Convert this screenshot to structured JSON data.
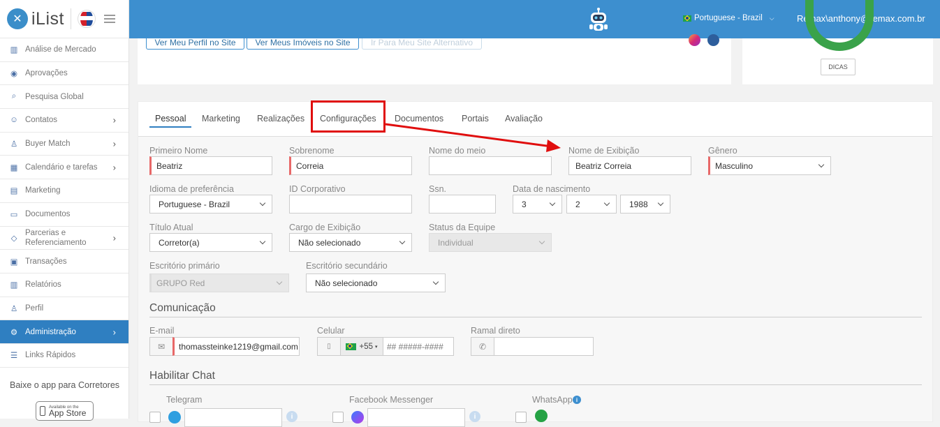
{
  "app": {
    "logo_text": "iList",
    "brand": "RE/MAX"
  },
  "sidebar": {
    "items": [
      {
        "label": "Análise de Mercado",
        "icon": "bar-chart-icon",
        "chevron": false
      },
      {
        "label": "Aprovações",
        "icon": "eye-icon",
        "chevron": false
      },
      {
        "label": "Pesquisa Global",
        "icon": "search-icon",
        "chevron": false
      },
      {
        "label": "Contatos",
        "icon": "contacts-icon",
        "chevron": true
      },
      {
        "label": "Buyer Match",
        "icon": "user-icon",
        "chevron": true
      },
      {
        "label": "Calendário e tarefas",
        "icon": "calendar-icon",
        "chevron": true
      },
      {
        "label": "Marketing",
        "icon": "newspaper-icon",
        "chevron": false
      },
      {
        "label": "Documentos",
        "icon": "folder-icon",
        "chevron": false
      },
      {
        "label": "Parcerias e Referenciamento",
        "icon": "tag-icon",
        "chevron": true
      },
      {
        "label": "Transações",
        "icon": "briefcase-icon",
        "chevron": false
      },
      {
        "label": "Relatórios",
        "icon": "bar-chart-icon",
        "chevron": false
      },
      {
        "label": "Perfil",
        "icon": "user-icon",
        "chevron": false
      },
      {
        "label": "Administração",
        "icon": "gear-icon",
        "chevron": true,
        "active": true
      },
      {
        "label": "Links Rápidos",
        "icon": "list-icon",
        "chevron": false
      }
    ],
    "app_text": "Baixe o app para Corretores",
    "appstore_small": "Available on the",
    "appstore_big": "App Store"
  },
  "topbar": {
    "language": "Portuguese - Brazil",
    "user": "Remax\\anthony@remax.com.br"
  },
  "top_card": {
    "btn1": "Ver Meu Perfil no Site",
    "btn2": "Ver Meus Imóveis no Site",
    "btn3": "Ir Para Meu Site Alternativo",
    "dicas": "DICAS"
  },
  "tabs": [
    "Pessoal",
    "Marketing",
    "Realizações",
    "Configurações",
    "Documentos",
    "Portais",
    "Avaliação"
  ],
  "form": {
    "primeiro_nome_label": "Primeiro Nome",
    "primeiro_nome": "Beatriz",
    "sobrenome_label": "Sobrenome",
    "sobrenome": "Correia",
    "nome_meio_label": "Nome do meio",
    "nome_meio": "",
    "nome_exibicao_label": "Nome de Exibição",
    "nome_exibicao": "Beatriz Correia",
    "genero_label": "Gênero",
    "genero": "Masculino",
    "idioma_label": "Idioma de preferência",
    "idioma": "Portuguese - Brazil",
    "id_corp_label": "ID Corporativo",
    "id_corp": "",
    "ssn_label": "Ssn.",
    "ssn": "",
    "nascimento_label": "Data de nascimento",
    "dia": "3",
    "mes": "2",
    "ano": "1988",
    "titulo_label": "Título Atual",
    "titulo": "Corretor(a)",
    "cargo_label": "Cargo de Exibição",
    "cargo": "Não selecionado",
    "status_label": "Status da Equipe",
    "status": "Individual",
    "escritorio_prim_label": "Escritório primário",
    "escritorio_prim": "GRUPO Red",
    "escritorio_sec_label": "Escritório secundário",
    "escritorio_sec": "Não selecionado"
  },
  "comunicacao": {
    "title": "Comunicação",
    "email_label": "E-mail",
    "email": "thomassteinke1219@gmail.com",
    "celular_label": "Celular",
    "country_code": "+55",
    "phone_placeholder": "## #####-####",
    "ramal_label": "Ramal direto",
    "ramal": ""
  },
  "chat": {
    "title": "Habilitar Chat",
    "telegram": "Telegram",
    "messenger": "Facebook Messenger",
    "whatsapp": "WhatsApp"
  },
  "colors": {
    "topbar": "#3d8fcf",
    "active_nav": "#2f7fc1",
    "required": "#e86868",
    "annotation": "#e00e0e"
  }
}
